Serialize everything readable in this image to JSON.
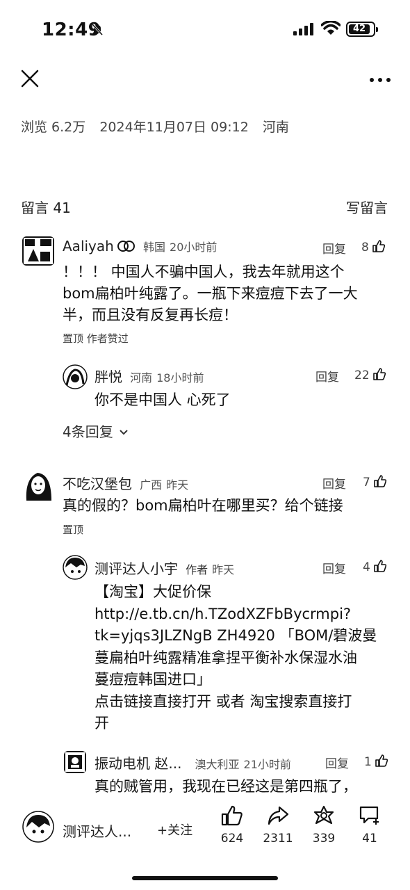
{
  "status": {
    "time": "12:49",
    "battery": "42"
  },
  "post_meta": {
    "views": "浏览 6.2万",
    "datetime": "2024年11月07日 09:12",
    "location": "河南"
  },
  "comments_section": {
    "title": "留言 41",
    "write_label": "写留言"
  },
  "reply_label": "回复",
  "comments": [
    {
      "name": "Aaliyah",
      "location": "韩国",
      "time": "20小时前",
      "likes": "8",
      "lines": [
        "！！！ 中国人不骗中国人，我去年就用这个",
        "bom扁柏叶纯露了。一瓶下来痘痘下去了一大",
        "半，而且没有反复再长痘！"
      ],
      "tags": "置顶 作者赞过"
    },
    {
      "name": "胖悦",
      "location": "河南",
      "time": "18小时前",
      "likes": "22",
      "lines": [
        "你不是中国人 心死了"
      ]
    },
    {
      "name": "不吃汉堡包",
      "location": "广西",
      "time": "昨天",
      "likes": "7",
      "lines": [
        "真的假的？bom扁柏叶在哪里买？给个链接"
      ],
      "tags": "置顶"
    },
    {
      "name": "测评达人小宇",
      "badge": "作者",
      "time": "昨天",
      "likes": "4",
      "lines": [
        "【淘宝】大促价保",
        "http://e.tb.cn/h.TZodXZFbBycrmpi?",
        "tk=yjqs3JLZNgB ZH4920 「BOM/碧波曼",
        "蔓扁柏叶纯露精准拿捏平衡补水保湿水油",
        "蔓痘痘韩国进口」",
        "点击链接直接打开 或者 淘宝搜索直接打",
        "开"
      ]
    },
    {
      "name": "振动电机 赵...",
      "location": "澳大利亚",
      "time": "21小时前",
      "likes": "1",
      "lines": [
        "真的贼管用，我现在已经这是第四瓶了，"
      ]
    }
  ],
  "more_replies": "4条回复",
  "bottom": {
    "author_name": "测评达人...",
    "follow_label": "+关注",
    "like_count": "624",
    "share_count": "2311",
    "recommend_count": "339",
    "comment_count": "41"
  }
}
